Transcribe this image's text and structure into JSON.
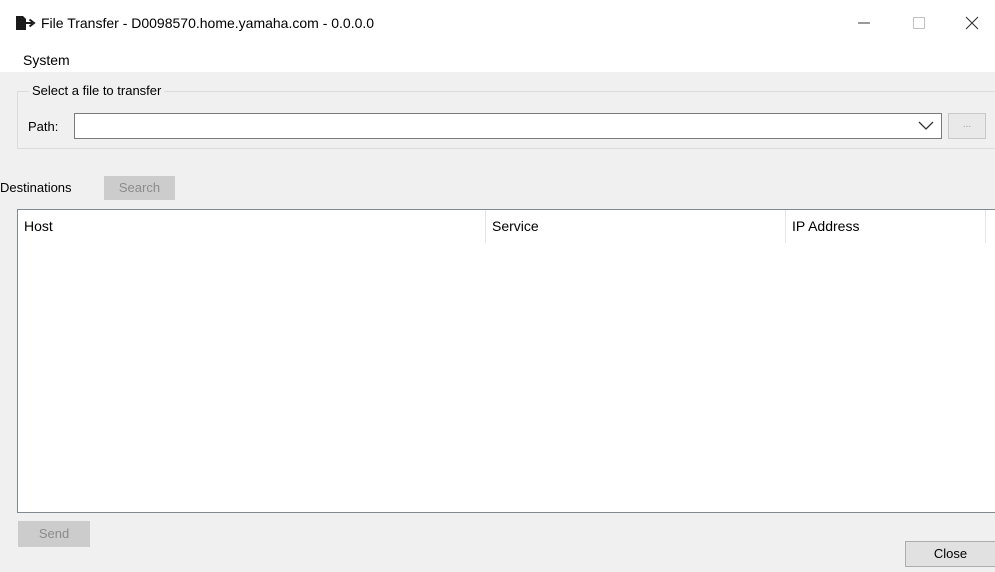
{
  "window": {
    "title": "File Transfer - D0098570.home.yamaha.com - 0.0.0.0",
    "icon": "file-transfer-icon",
    "controls": {
      "minimize": "minimize-icon",
      "maximize": "maximize-icon",
      "close": "close-icon"
    }
  },
  "menu": {
    "items": [
      "System"
    ]
  },
  "file_select": {
    "group_title": "Select a file to transfer",
    "path_label": "Path:",
    "path_value": "",
    "browse_label": "..."
  },
  "destinations": {
    "label": "Destinations",
    "search_label": "Search",
    "columns": [
      "Host",
      "Service",
      "IP Address"
    ],
    "rows": []
  },
  "footer": {
    "send_label": "Send",
    "close_label": "Close"
  }
}
